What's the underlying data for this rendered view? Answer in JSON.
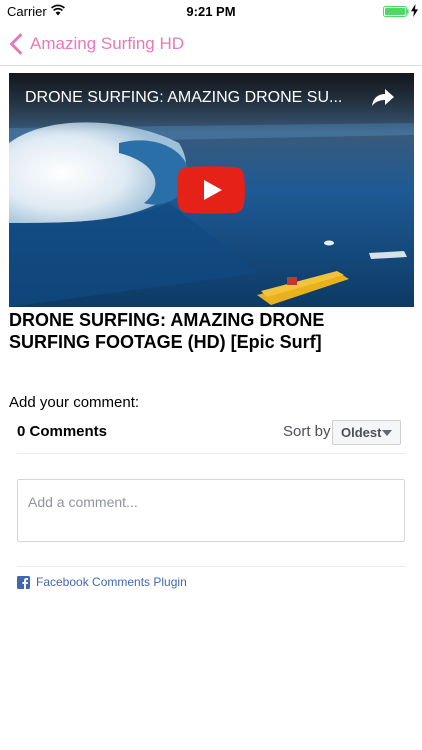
{
  "status_bar": {
    "carrier": "Carrier",
    "time": "9:21 PM"
  },
  "nav": {
    "back_title": "Amazing Surfing HD",
    "accent_color": "#e979b6"
  },
  "video": {
    "overlay_title": "DRONE SURFING: AMAZING DRONE SU...",
    "heading": "DRONE SURFING: AMAZING DRONE SURFING FOOTAGE (HD) [Epic Surf]"
  },
  "comments": {
    "add_label": "Add your comment:",
    "count_label": "0 Comments",
    "sort_label": "Sort by",
    "sort_selected": "Oldest",
    "input_placeholder": "Add a comment...",
    "plugin_label": "Facebook Comments Plugin"
  },
  "icons": {
    "wifi": "wifi-icon",
    "battery": "battery-icon",
    "back": "chevron-left-icon",
    "share": "share-arrow-icon",
    "play": "youtube-play-icon",
    "facebook": "facebook-icon"
  }
}
